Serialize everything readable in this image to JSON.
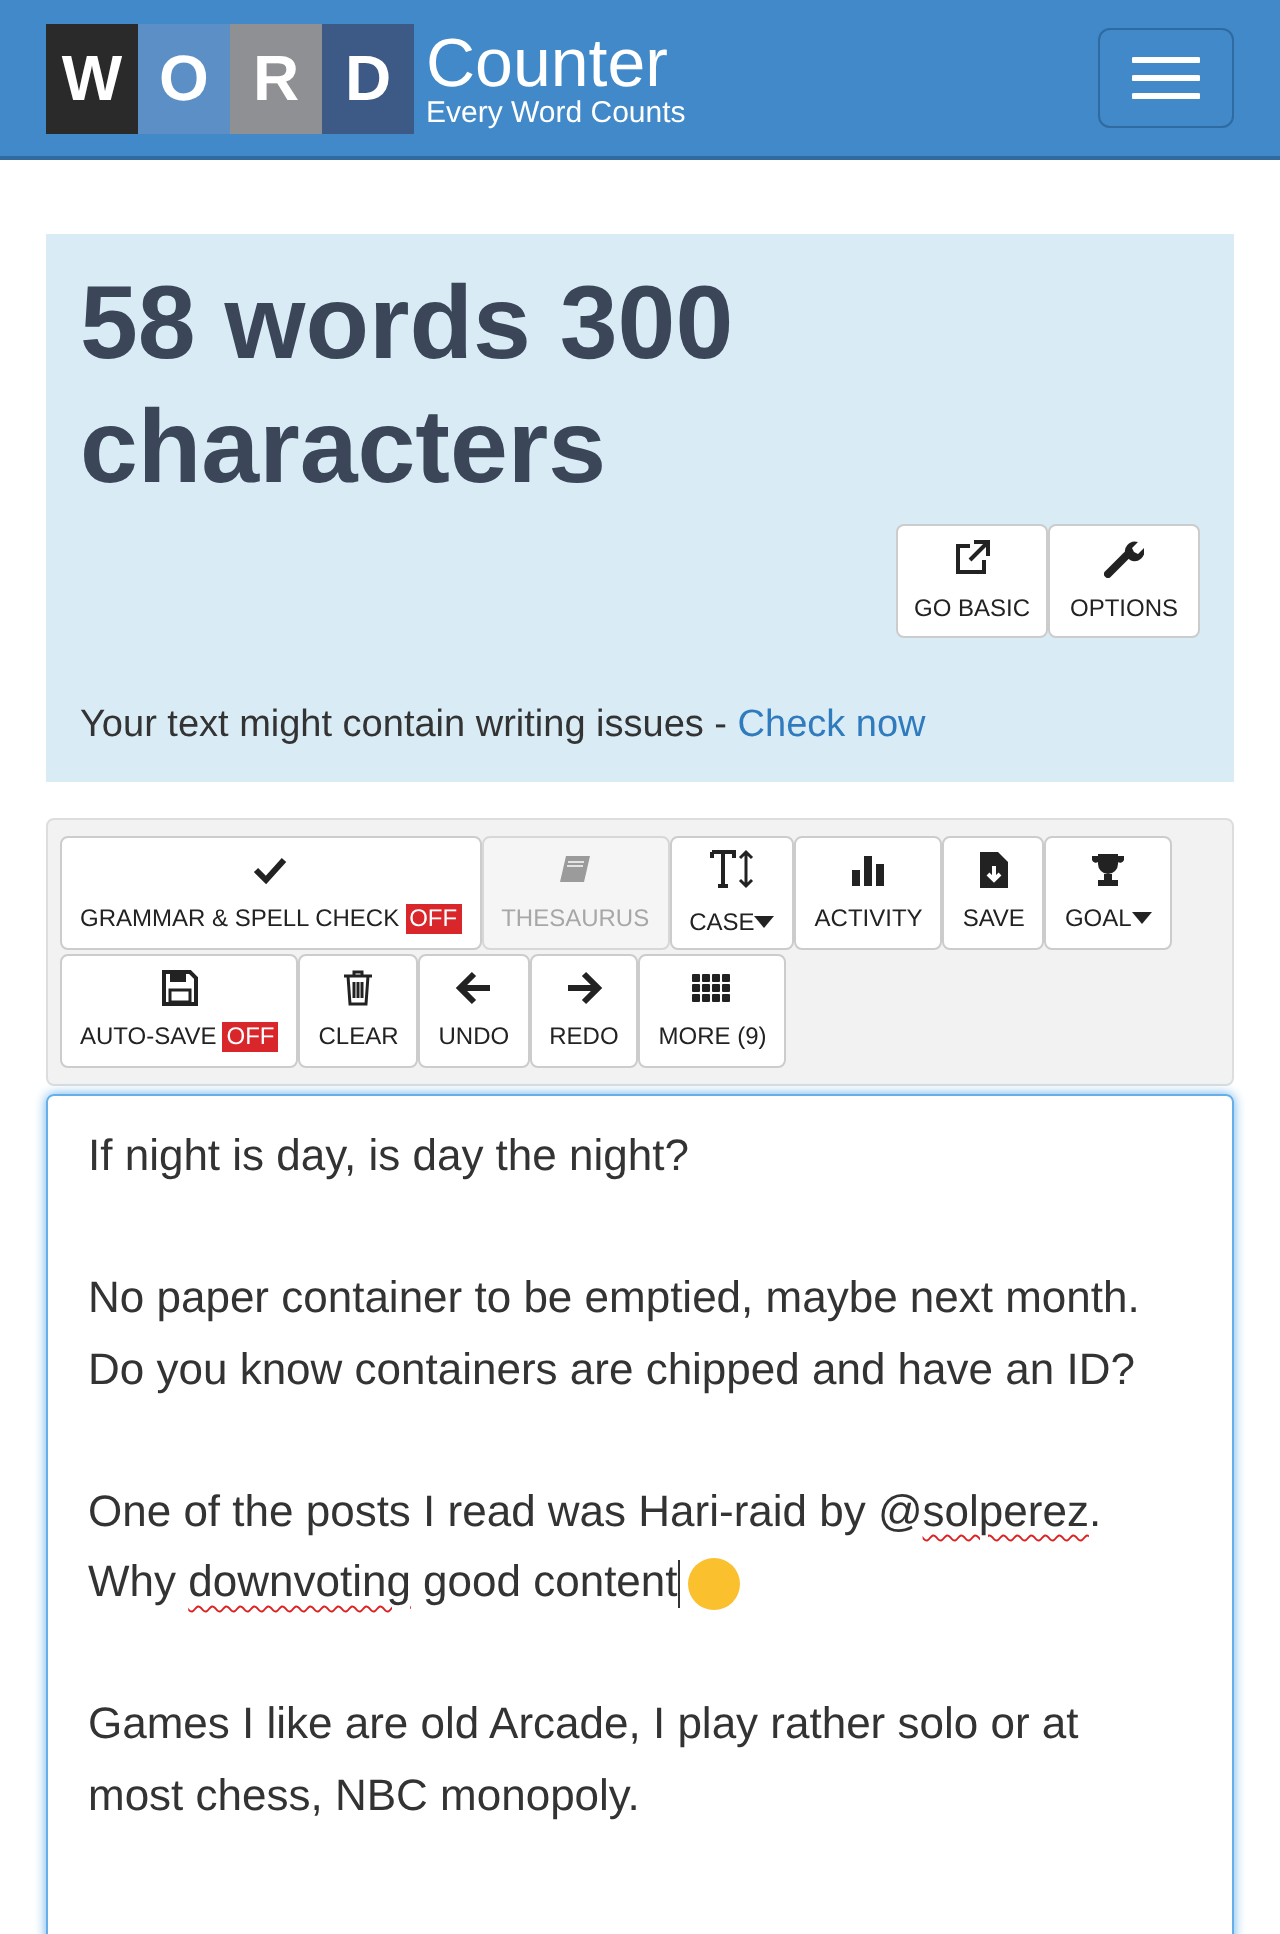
{
  "logo": {
    "letters": [
      "W",
      "O",
      "R",
      "D"
    ],
    "name": "Counter",
    "tagline": "Every Word Counts"
  },
  "stats": {
    "headline": "58 words 300 characters",
    "buttons": [
      "GO BASIC",
      "OPTIONS"
    ],
    "notice": "Your text might contain writing issues - ",
    "notice_link": "Check now"
  },
  "toolbar": [
    {
      "label": "GRAMMAR & SPELL CHECK",
      "badge": "OFF",
      "disabled": false,
      "dropdown": false
    },
    {
      "label": "THESAURUS",
      "disabled": true,
      "dropdown": false
    },
    {
      "label": "CASE",
      "disabled": false,
      "dropdown": true
    },
    {
      "label": "ACTIVITY",
      "disabled": false,
      "dropdown": false
    },
    {
      "label": "SAVE",
      "disabled": false,
      "dropdown": false
    },
    {
      "label": "GOAL",
      "disabled": false,
      "dropdown": true
    },
    {
      "label": "AUTO-SAVE",
      "badge": "OFF",
      "disabled": false,
      "dropdown": false
    },
    {
      "label": "CLEAR",
      "disabled": false,
      "dropdown": false
    },
    {
      "label": "UNDO",
      "disabled": false,
      "dropdown": false
    },
    {
      "label": "REDO",
      "disabled": false,
      "dropdown": false
    },
    {
      "label": "MORE (9)",
      "disabled": false,
      "dropdown": false
    }
  ],
  "editor": {
    "paragraphs": [
      [
        {
          "text": "If night is day, is day the night?",
          "misspelled": false
        }
      ],
      [
        {
          "text": "No paper container to be emptied, maybe next month. Do you know containers are chipped and have an ID?",
          "misspelled": false
        }
      ],
      [
        {
          "text": "One of the posts I read was Hari-raid by @",
          "misspelled": false
        },
        {
          "text": "solperez",
          "misspelled": true
        },
        {
          "text": ". Why ",
          "misspelled": false
        },
        {
          "text": "downvoting",
          "misspelled": true
        },
        {
          "text": " good content",
          "misspelled": false
        },
        {
          "kind": "cursor"
        },
        {
          "kind": "emoji"
        }
      ],
      [
        {
          "text": "Games I like are old Arcade, I play rather solo or at most chess, NBC monopoly.",
          "misspelled": false
        }
      ]
    ]
  }
}
